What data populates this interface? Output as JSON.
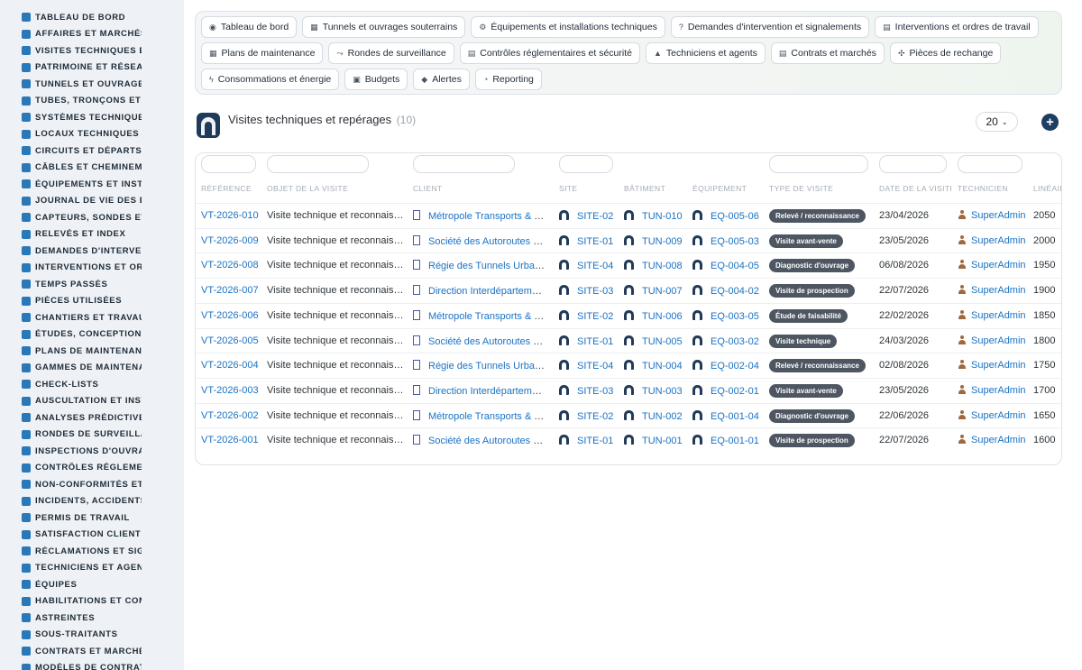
{
  "sidebar": {
    "items": [
      {
        "label": "TABLEAU DE BORD",
        "icon": "gauge-icon"
      },
      {
        "label": "AFFAIRES ET MARCHÉS",
        "icon": "target-icon"
      },
      {
        "label": "VISITES TECHNIQUES ET REPÉRAGES",
        "icon": "walk-icon"
      },
      {
        "label": "PATRIMOINE ET RÉSEAUX",
        "icon": "network-icon"
      },
      {
        "label": "TUNNELS ET OUVRAGES",
        "icon": "tunnel-icon"
      },
      {
        "label": "TUBES, TRONÇONS ET ZONES",
        "icon": "segments-icon"
      },
      {
        "label": "SYSTÈMES TECHNIQUES",
        "icon": "sitemap-icon"
      },
      {
        "label": "LOCAUX TECHNIQUES ET ABRIS",
        "icon": "grid-icon"
      },
      {
        "label": "CIRCUITS ET DÉPARTS ÉLECTRIQUES",
        "icon": "circuit-icon"
      },
      {
        "label": "CÂBLES ET CHEMINEMENTS",
        "icon": "cable-icon"
      },
      {
        "label": "ÉQUIPEMENTS ET INSTALLATIONS",
        "icon": "cogs-icon"
      },
      {
        "label": "JOURNAL DE VIE DES ÉQUIPEMENTS",
        "icon": "history-icon"
      },
      {
        "label": "CAPTEURS, SONDES ET COMPTEURS",
        "icon": "sensor-icon"
      },
      {
        "label": "RELEVÉS ET INDEX",
        "icon": "list-icon"
      },
      {
        "label": "DEMANDES D'INTERVENTION",
        "icon": "question-icon"
      },
      {
        "label": "INTERVENTIONS ET ORDRES DE TRAVAIL",
        "icon": "clipboard-icon"
      },
      {
        "label": "TEMPS PASSÉS",
        "icon": "clock-icon"
      },
      {
        "label": "PIÈCES UTILISÉES",
        "icon": "list-icon"
      },
      {
        "label": "CHANTIERS ET TRAVAUX",
        "icon": "hammer-icon"
      },
      {
        "label": "ÉTUDES, CONCEPTION ET EXPERTISES",
        "icon": "pencil-icon"
      },
      {
        "label": "PLANS DE MAINTENANCE",
        "icon": "calendar-icon"
      },
      {
        "label": "GAMMES DE MAINTENANCE",
        "icon": "list-ol-icon"
      },
      {
        "label": "CHECK-LISTS",
        "icon": "checklist-icon"
      },
      {
        "label": "AUSCULTATION ET INSTRUMENTATION",
        "icon": "thermometer-icon"
      },
      {
        "label": "ANALYSES PRÉDICTIVES",
        "icon": "chart-line-icon"
      },
      {
        "label": "RONDES DE SURVEILLANCE",
        "icon": "route-icon"
      },
      {
        "label": "INSPECTIONS D'OUVRAGES",
        "icon": "search-icon"
      },
      {
        "label": "CONTRÔLES RÉGLEMENTAIRES",
        "icon": "clipboard-check-icon"
      },
      {
        "label": "NON-CONFORMITÉS ET ANOMALIES",
        "icon": "alert-circle-icon"
      },
      {
        "label": "INCIDENTS, ACCIDENTS ET ÉVÉNEMENTS",
        "icon": "warning-icon"
      },
      {
        "label": "PERMIS DE TRAVAIL",
        "icon": "file-signature-icon"
      },
      {
        "label": "SATISFACTION CLIENT",
        "icon": "smile-icon"
      },
      {
        "label": "RÉCLAMATIONS ET SIGNALEMENTS",
        "icon": "comment-icon"
      },
      {
        "label": "TECHNICIENS ET AGENTS",
        "icon": "hard-hat-icon"
      },
      {
        "label": "ÉQUIPES",
        "icon": "users-icon"
      },
      {
        "label": "HABILITATIONS ET COMPÉTENCES",
        "icon": "certificate-icon"
      },
      {
        "label": "ASTREINTES",
        "icon": "phone-icon"
      },
      {
        "label": "SOUS-TRAITANTS",
        "icon": "handshake-icon"
      },
      {
        "label": "CONTRATS ET MARCHÉS",
        "icon": "file-contract-icon"
      },
      {
        "label": "MODÈLES DE CONTRATS",
        "icon": "file-icon"
      }
    ]
  },
  "topnav": {
    "row1": [
      {
        "label": "Tableau de bord",
        "icon": "gauge-icon",
        "glyph": "◉"
      },
      {
        "label": "Tunnels et ouvrages souterrains",
        "icon": "building-icon",
        "glyph": "▦"
      },
      {
        "label": "Équipements et installations techniques",
        "icon": "cogs-icon",
        "glyph": "⚙"
      },
      {
        "label": "Demandes d'intervention et signalements",
        "icon": "question-icon",
        "glyph": "?"
      },
      {
        "label": "Interventions et ordres de travail",
        "icon": "clipboard-icon",
        "glyph": "▤"
      }
    ],
    "row2": [
      {
        "label": "Plans de maintenance",
        "icon": "calendar-icon",
        "glyph": "▦"
      },
      {
        "label": "Rondes de surveillance",
        "icon": "route-icon",
        "glyph": "⤳"
      },
      {
        "label": "Contrôles réglementaires et sécurité",
        "icon": "clipboard-check-icon",
        "glyph": "▤"
      },
      {
        "label": "Techniciens et agents",
        "icon": "hard-hat-icon",
        "glyph": "▲"
      },
      {
        "label": "Contrats et marchés",
        "icon": "file-contract-icon",
        "glyph": "▤"
      },
      {
        "label": "Pièces de rechange",
        "icon": "puzzle-icon",
        "glyph": "✣"
      }
    ],
    "row3": [
      {
        "label": "Consommations et énergie",
        "icon": "bolt-icon",
        "glyph": "ϟ"
      },
      {
        "label": "Budgets",
        "icon": "money-icon",
        "glyph": "▣"
      },
      {
        "label": "Alertes",
        "icon": "bell-icon",
        "glyph": "◆"
      },
      {
        "label": "Reporting",
        "icon": "pie-chart-icon",
        "glyph": "◔"
      }
    ]
  },
  "page": {
    "title": "Visites techniques et repérages",
    "count": "(10)",
    "page_size": "20"
  },
  "table": {
    "headers": [
      "RÉFÉRENCE",
      "OBJET DE LA VISITE",
      "CLIENT",
      "SITE",
      "BÂTIMENT",
      "ÉQUIPEMENT",
      "TYPE DE VISITE",
      "DATE DE LA VISITE",
      "TECHNICIEN",
      "LINÉAIRE"
    ],
    "rows": [
      {
        "ref": "VT-2026-010",
        "objet": "Visite technique et reconnaissance",
        "client": "Métropole Transports & Tunnels",
        "site": "SITE-02",
        "batiment": "TUN-010",
        "equipement": "EQ-005-06",
        "type": "Relevé / reconnaissance",
        "date": "23/04/2026",
        "technicien": "SuperAdmin",
        "lineaire": "2050"
      },
      {
        "ref": "VT-2026-009",
        "objet": "Visite technique et reconnaissance",
        "client": "Société des Autoroutes du Sud",
        "site": "SITE-01",
        "batiment": "TUN-009",
        "equipement": "EQ-005-03",
        "type": "Visite avant-vente",
        "date": "23/05/2026",
        "technicien": "SuperAdmin",
        "lineaire": "2000"
      },
      {
        "ref": "VT-2026-008",
        "objet": "Visite technique et reconnaissance",
        "client": "Régie des Tunnels Urbains",
        "site": "SITE-04",
        "batiment": "TUN-008",
        "equipement": "EQ-004-05",
        "type": "Diagnostic d'ouvrage",
        "date": "06/08/2026",
        "technicien": "SuperAdmin",
        "lineaire": "1950"
      },
      {
        "ref": "VT-2026-007",
        "objet": "Visite technique et reconnaissance",
        "client": "Direction Interdépartementale des Routes",
        "site": "SITE-03",
        "batiment": "TUN-007",
        "equipement": "EQ-004-02",
        "type": "Visite de prospection",
        "date": "22/07/2026",
        "technicien": "SuperAdmin",
        "lineaire": "1900"
      },
      {
        "ref": "VT-2026-006",
        "objet": "Visite technique et reconnaissance",
        "client": "Métropole Transports & Tunnels",
        "site": "SITE-02",
        "batiment": "TUN-006",
        "equipement": "EQ-003-05",
        "type": "Étude de faisabilité",
        "date": "22/02/2026",
        "technicien": "SuperAdmin",
        "lineaire": "1850"
      },
      {
        "ref": "VT-2026-005",
        "objet": "Visite technique et reconnaissance",
        "client": "Société des Autoroutes du Sud",
        "site": "SITE-01",
        "batiment": "TUN-005",
        "equipement": "EQ-003-02",
        "type": "Visite technique",
        "date": "24/03/2026",
        "technicien": "SuperAdmin",
        "lineaire": "1800"
      },
      {
        "ref": "VT-2026-004",
        "objet": "Visite technique et reconnaissance",
        "client": "Régie des Tunnels Urbains",
        "site": "SITE-04",
        "batiment": "TUN-004",
        "equipement": "EQ-002-04",
        "type": "Relevé / reconnaissance",
        "date": "02/08/2026",
        "technicien": "SuperAdmin",
        "lineaire": "1750"
      },
      {
        "ref": "VT-2026-003",
        "objet": "Visite technique et reconnaissance",
        "client": "Direction Interdépartementale des Routes",
        "site": "SITE-03",
        "batiment": "TUN-003",
        "equipement": "EQ-002-01",
        "type": "Visite avant-vente",
        "date": "23/05/2026",
        "technicien": "SuperAdmin",
        "lineaire": "1700"
      },
      {
        "ref": "VT-2026-002",
        "objet": "Visite technique et reconnaissance",
        "client": "Métropole Transports & Tunnels",
        "site": "SITE-02",
        "batiment": "TUN-002",
        "equipement": "EQ-001-04",
        "type": "Diagnostic d'ouvrage",
        "date": "22/06/2026",
        "technicien": "SuperAdmin",
        "lineaire": "1650"
      },
      {
        "ref": "VT-2026-001",
        "objet": "Visite technique et reconnaissance",
        "client": "Société des Autoroutes du Sud",
        "site": "SITE-01",
        "batiment": "TUN-001",
        "equipement": "EQ-001-01",
        "type": "Visite de prospection",
        "date": "22/07/2026",
        "technicien": "SuperAdmin",
        "lineaire": "1600"
      }
    ]
  },
  "colors": {
    "link": "#1a72c4",
    "badge": "#4d5661",
    "accent": "#1d3d63",
    "sidebar_bg": "#eef2f6"
  }
}
